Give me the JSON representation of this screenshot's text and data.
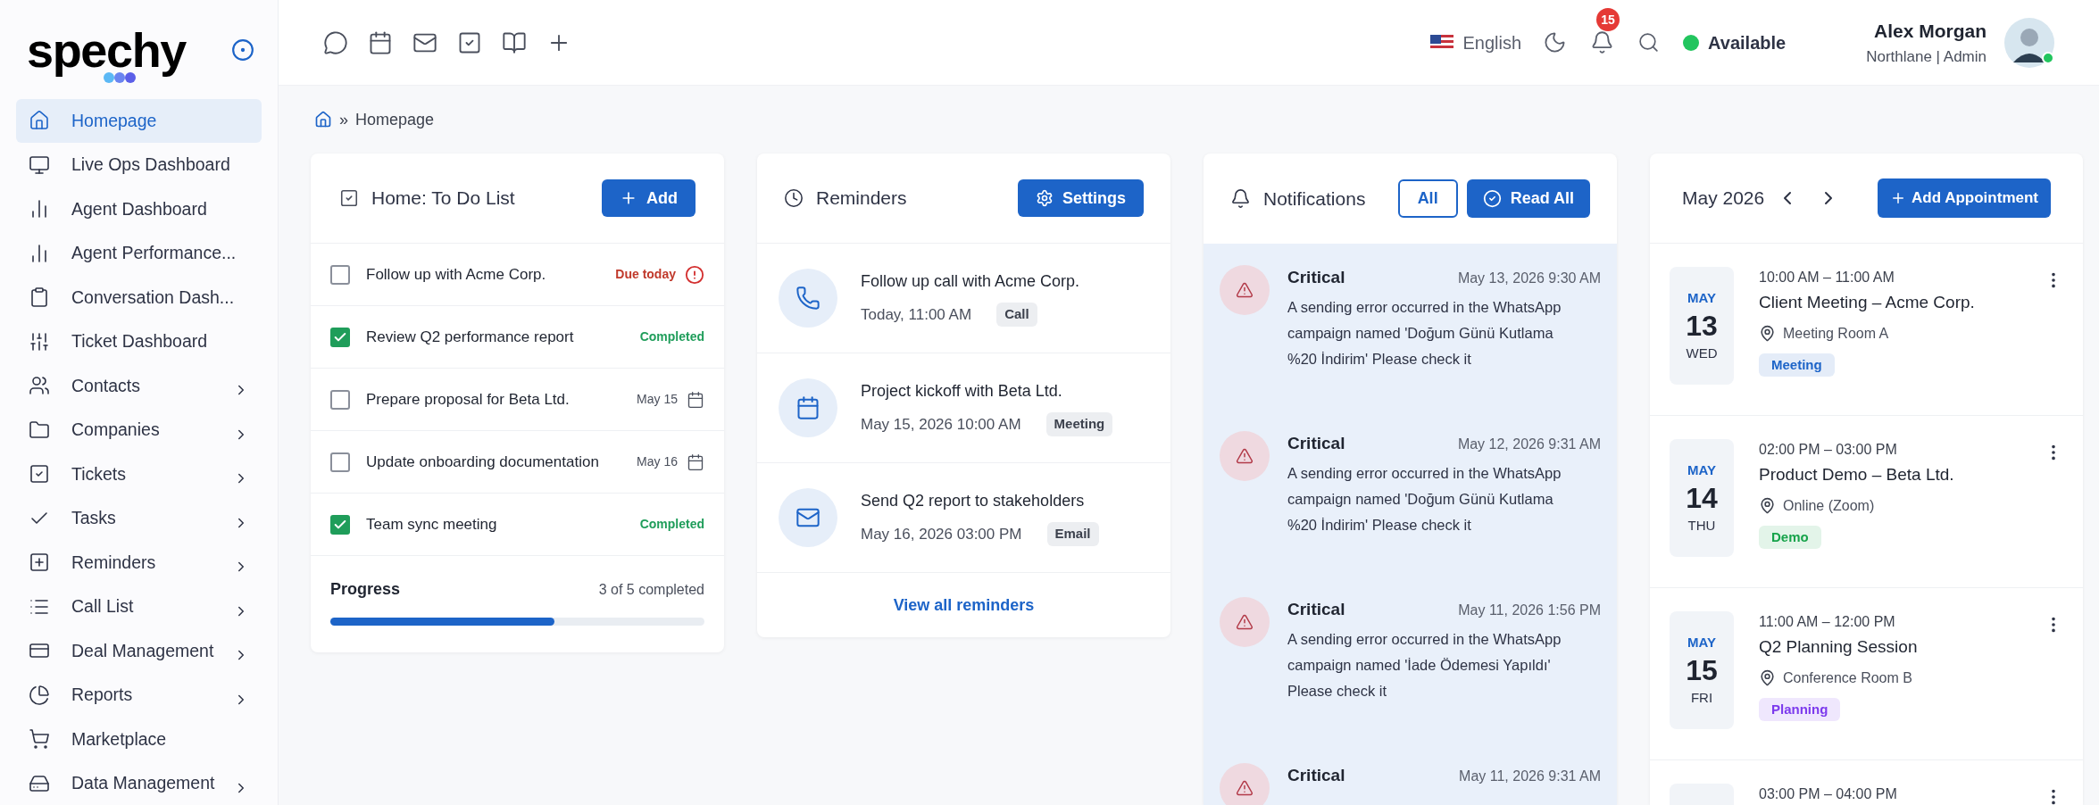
{
  "logo": {
    "text": "spechy"
  },
  "sidebar": {
    "items": [
      {
        "label": "Homepage",
        "selected": true,
        "expandable": false
      },
      {
        "label": "Live Ops Dashboard",
        "selected": false,
        "expandable": false
      },
      {
        "label": "Agent Dashboard",
        "selected": false,
        "expandable": false
      },
      {
        "label": "Agent Performance...",
        "selected": false,
        "expandable": false
      },
      {
        "label": "Conversation Dash...",
        "selected": false,
        "expandable": false
      },
      {
        "label": "Ticket Dashboard",
        "selected": false,
        "expandable": false
      },
      {
        "label": "Contacts",
        "selected": false,
        "expandable": true
      },
      {
        "label": "Companies",
        "selected": false,
        "expandable": true
      },
      {
        "label": "Tickets",
        "selected": false,
        "expandable": true
      },
      {
        "label": "Tasks",
        "selected": false,
        "expandable": true
      },
      {
        "label": "Reminders",
        "selected": false,
        "expandable": true
      },
      {
        "label": "Call List",
        "selected": false,
        "expandable": true
      },
      {
        "label": "Deal Management",
        "selected": false,
        "expandable": true
      },
      {
        "label": "Reports",
        "selected": false,
        "expandable": true
      },
      {
        "label": "Marketplace",
        "selected": false,
        "expandable": false
      },
      {
        "label": "Data Management",
        "selected": false,
        "expandable": true
      }
    ]
  },
  "topbar": {
    "language": "English",
    "notification_count": "15",
    "status": "Available",
    "user": {
      "name": "Alex Morgan",
      "org": "Northlane | Admin"
    }
  },
  "breadcrumb": {
    "separator": "»",
    "current": "Homepage"
  },
  "todo": {
    "title": "Home: To Do List",
    "add_button": "Add",
    "items": [
      {
        "label": "Follow up with Acme Corp.",
        "checked": false,
        "kind": "due",
        "status": "Due today"
      },
      {
        "label": "Review Q2 performance report",
        "checked": true,
        "kind": "done",
        "status": "Completed"
      },
      {
        "label": "Prepare proposal for Beta Ltd.",
        "checked": false,
        "kind": "date",
        "status": "May 15"
      },
      {
        "label": "Update onboarding documentation",
        "checked": false,
        "kind": "date",
        "status": "May 16"
      },
      {
        "label": "Team sync meeting",
        "checked": true,
        "kind": "done",
        "status": "Completed"
      }
    ],
    "progress": {
      "label": "Progress",
      "reading": "3 of 5 completed",
      "level": 0.6
    }
  },
  "reminders": {
    "title": "Reminders",
    "settings_button": "Settings",
    "items": [
      {
        "kind": "call",
        "title": "Follow up call with Acme Corp.",
        "time": "Today, 11:00 AM",
        "tag": "Call"
      },
      {
        "kind": "meeting",
        "title": "Project kickoff with Beta Ltd.",
        "time": "May 15, 2026 10:00 AM",
        "tag": "Meeting"
      },
      {
        "kind": "email",
        "title": "Send Q2 report to stakeholders",
        "time": "May 16, 2026 03:00 PM",
        "tag": "Email"
      }
    ],
    "view_all": "View all reminders"
  },
  "notifications": {
    "title": "Notifications",
    "filter_button": "All",
    "read_all_button": "Read All",
    "items": [
      {
        "level": "Critical",
        "time": "May 13, 2026 9:30 AM",
        "message": "A sending error occurred in the WhatsApp campaign named 'Doğum Günü Kutlama %20 İndirim' Please check it"
      },
      {
        "level": "Critical",
        "time": "May 12, 2026 9:31 AM",
        "message": "A sending error occurred in the WhatsApp campaign named 'Doğum Günü Kutlama %20 İndirim' Please check it"
      },
      {
        "level": "Critical",
        "time": "May 11, 2026 1:56 PM",
        "message": "A sending error occurred in the WhatsApp campaign named 'İade Ödemesi Yapıldı' Please check it"
      },
      {
        "level": "Critical",
        "time": "May 11, 2026 9:31 AM"
      }
    ]
  },
  "calendar": {
    "month": "May 2026",
    "add_button": "Add Appointment",
    "appointments": [
      {
        "month": "MAY",
        "day": "13",
        "weekday": "WED",
        "time": "10:00 AM – 11:00 AM",
        "title": "Client Meeting – Acme Corp.",
        "location": "Meeting Room A",
        "tag": "Meeting",
        "color": "#1d64c8"
      },
      {
        "month": "MAY",
        "day": "14",
        "weekday": "THU",
        "time": "02:00 PM – 03:00 PM",
        "title": "Product Demo – Beta Ltd.",
        "location": "Online (Zoom)",
        "tag": "Demo",
        "color": "#16a34a"
      },
      {
        "month": "MAY",
        "day": "15",
        "weekday": "FRI",
        "time": "11:00 AM – 12:00 PM",
        "title": "Q2 Planning Session",
        "location": "Conference Room B",
        "tag": "Planning",
        "color": "#7c3aed"
      },
      {
        "time": "03:00 PM – 04:00 PM"
      }
    ]
  }
}
